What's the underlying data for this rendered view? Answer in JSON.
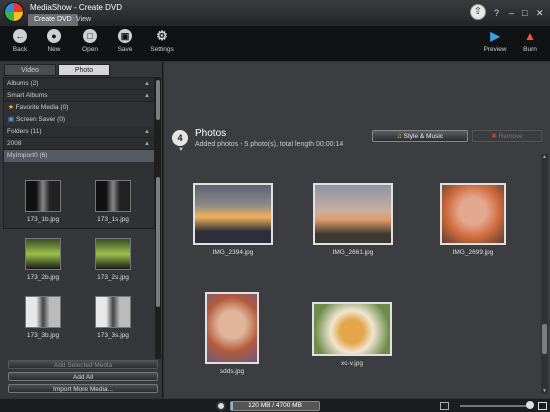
{
  "app": {
    "title": "MediaShow - Create DVD",
    "tabs": [
      "Create DVD",
      "View"
    ],
    "window_controls": [
      "?",
      "–",
      "□",
      "✕"
    ]
  },
  "toolbar": {
    "items": [
      {
        "label": "Back",
        "icon": "back-arrow-icon"
      },
      {
        "label": "New",
        "icon": "new-disc-icon"
      },
      {
        "label": "Open",
        "icon": "open-icon"
      },
      {
        "label": "Save",
        "icon": "save-icon"
      },
      {
        "label": "Settings",
        "icon": "gear-icon"
      }
    ],
    "right_items": [
      {
        "label": "Preview",
        "icon": "play-icon"
      },
      {
        "label": "Burn",
        "icon": "flame-icon"
      }
    ]
  },
  "left": {
    "tabs": [
      "Video",
      "Photo"
    ],
    "active_tab": "Photo",
    "tree": [
      {
        "label": "Albums (2)",
        "type": "header"
      },
      {
        "label": "Smart Albums",
        "type": "header"
      },
      {
        "label": "Favorite Media (0)",
        "type": "sub",
        "icon": "star-icon"
      },
      {
        "label": "Screen Saver (0)",
        "type": "sub",
        "icon": "monitor-icon"
      },
      {
        "label": "Folders (11)",
        "type": "header"
      },
      {
        "label": "2008",
        "type": "header"
      },
      {
        "label": "MyImport0 (6)",
        "type": "selected"
      }
    ],
    "media": [
      "173_1b.jpg",
      "173_1s.jpg",
      "173_2b.jpg",
      "173_2s.jpg",
      "173_3b.jpg",
      "173_3s.jpg"
    ],
    "buttons": {
      "add_selected": "Add Selected Media",
      "add_all": "Add All",
      "import_more": "Import More Media..."
    }
  },
  "main": {
    "step": "4",
    "title": "Photos",
    "subtitle": "Added photos - 5 photo(s), total length 00:00:14",
    "style_music": "Style & Music",
    "remove": "Remove",
    "photos": [
      {
        "name": "IMG_2394.jpg",
        "colors": [
          "#6b6d7c",
          "#f2b25a",
          "#2c2f3a"
        ]
      },
      {
        "name": "IMG_2661.jpg",
        "colors": [
          "#8c94a3",
          "#e09a66",
          "#3a3830"
        ]
      },
      {
        "name": "IMG_2699.jpg",
        "colors": [
          "#d06a3c",
          "#e3a88f",
          "#5a3f33"
        ]
      },
      {
        "name": "sdds.jpg",
        "colors": [
          "#b25a3c",
          "#e0b59a",
          "#6b5a7c"
        ]
      },
      {
        "name": "xc-v.jpg",
        "colors": [
          "#6d8b4a",
          "#e3a64a",
          "#f0e6d0"
        ]
      }
    ]
  },
  "status": {
    "capacity_label": "120 MB / 4700 MB",
    "capacity_used": 0.026
  }
}
